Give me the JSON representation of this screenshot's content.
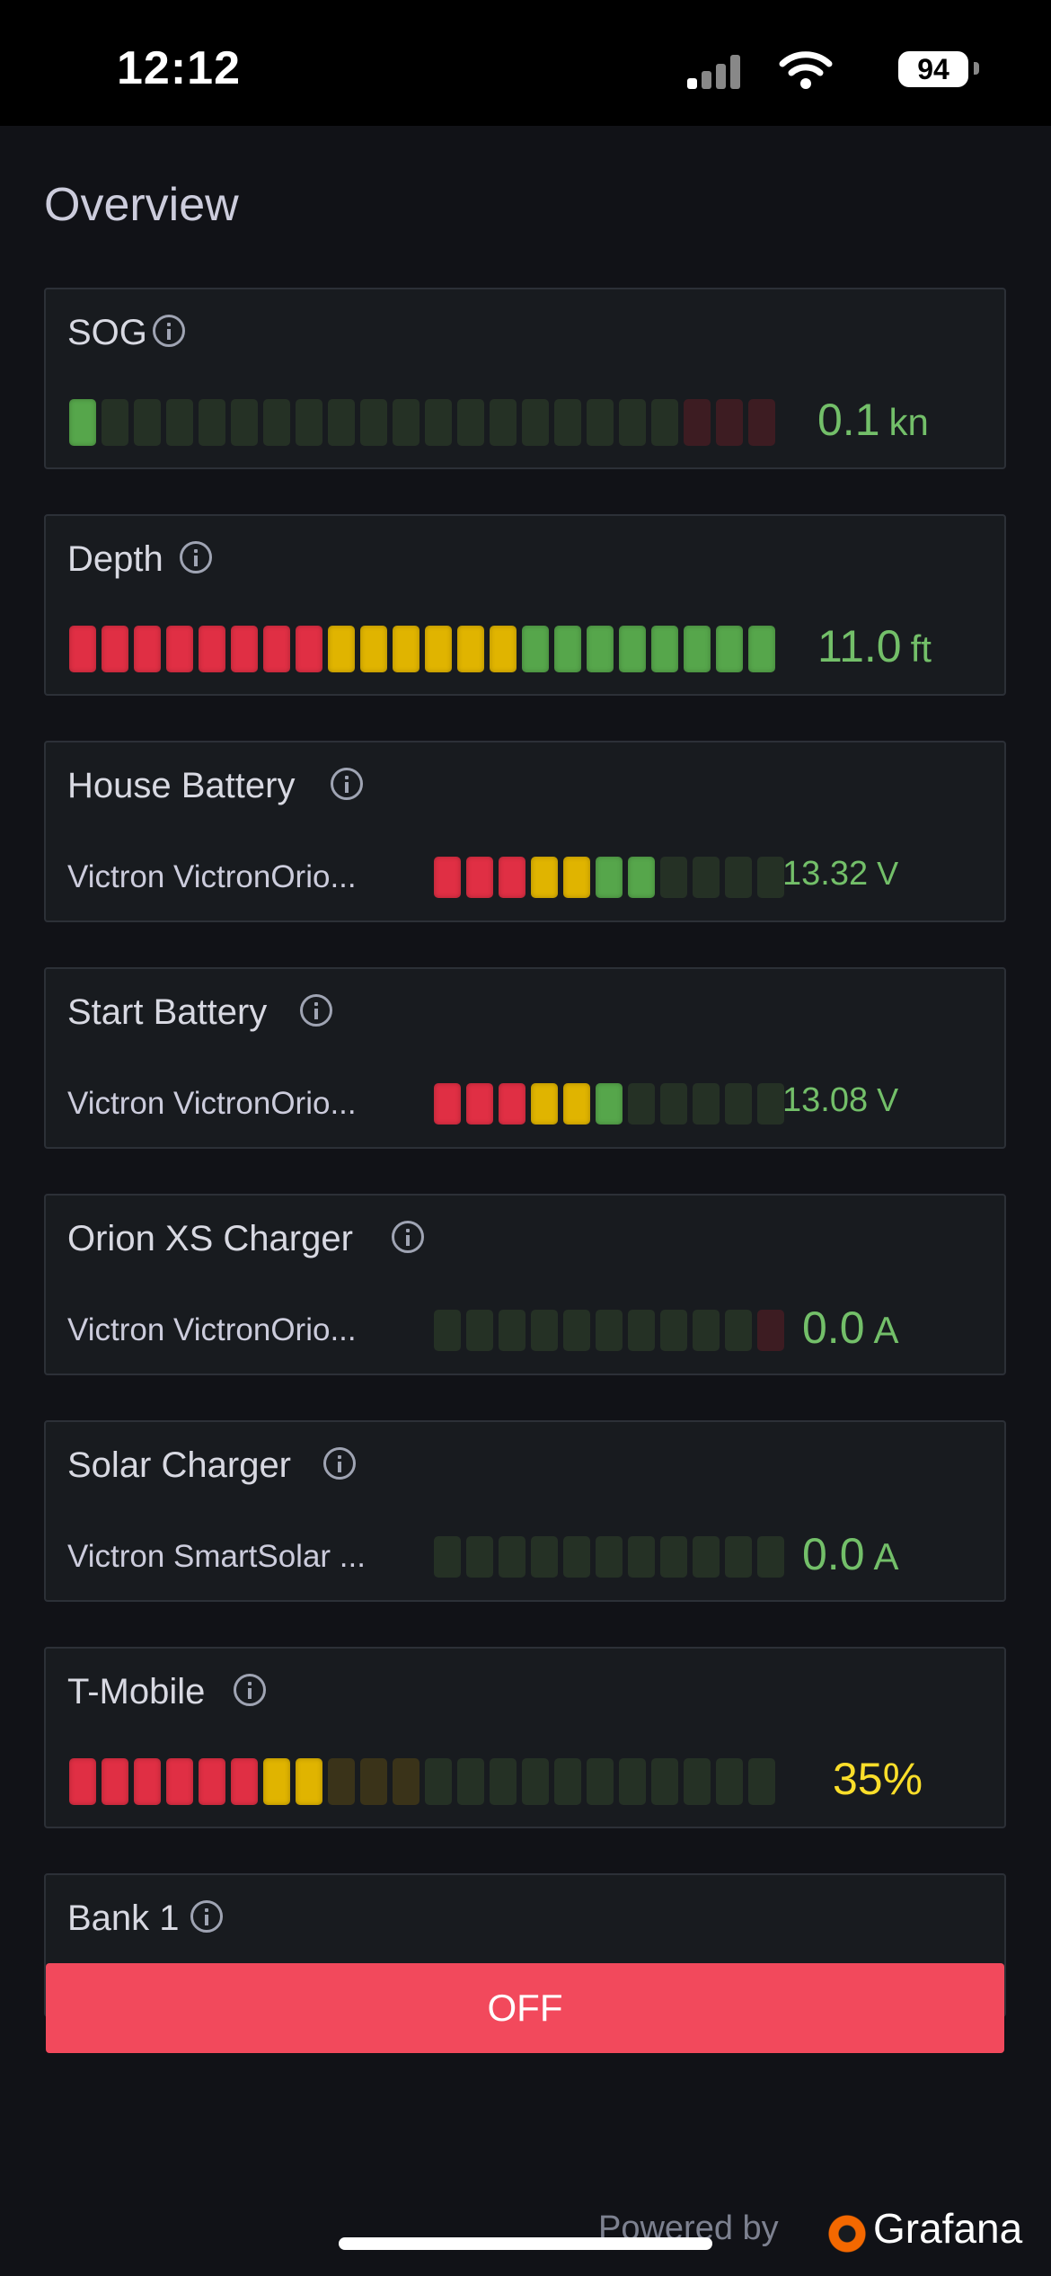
{
  "status_bar": {
    "time": "12:12",
    "battery": "94",
    "signal_icon": "cellular-signal-icon",
    "wifi_icon": "wifi-icon"
  },
  "page": {
    "title": "Overview"
  },
  "colors": {
    "red": "#e02f44",
    "yellow": "#e0b400",
    "green": "#56a64b",
    "dim_green": "#253125",
    "dim_red": "#3d1c22",
    "dim_yellow": "#3a3319",
    "value_green": "#73bf69",
    "value_yellow": "#fade2a"
  },
  "panels": [
    {
      "title": "SOG",
      "value": "0.1",
      "unit": "kn",
      "value_color": "value_green",
      "segments": 22,
      "lit": 1,
      "thresholds": [
        "g",
        "g",
        "g",
        "g",
        "g",
        "g",
        "g",
        "g",
        "g",
        "g",
        "g",
        "g",
        "g",
        "g",
        "g",
        "g",
        "g",
        "g",
        "g",
        "r",
        "r",
        "r"
      ]
    },
    {
      "title": "Depth",
      "value": "11.0",
      "unit": "ft",
      "value_color": "value_green",
      "segments": 22,
      "lit": 22,
      "thresholds": [
        "r",
        "r",
        "r",
        "r",
        "r",
        "r",
        "r",
        "r",
        "y",
        "y",
        "y",
        "y",
        "y",
        "y",
        "g",
        "g",
        "g",
        "g",
        "g",
        "g",
        "g",
        "g"
      ]
    },
    {
      "title": "House Battery",
      "device": "Victron VictronOrio...",
      "value": "13.32",
      "unit": "V",
      "value_color": "value_green",
      "segments": 11,
      "lit": 7,
      "thresholds": [
        "r",
        "r",
        "r",
        "y",
        "y",
        "g",
        "g",
        "g",
        "g",
        "g",
        "g"
      ]
    },
    {
      "title": "Start Battery",
      "device": "Victron VictronOrio...",
      "value": "13.08",
      "unit": "V",
      "value_color": "value_green",
      "segments": 11,
      "lit": 6,
      "thresholds": [
        "r",
        "r",
        "r",
        "y",
        "y",
        "g",
        "g",
        "g",
        "g",
        "g",
        "g"
      ]
    },
    {
      "title": "Orion XS Charger",
      "device": "Victron VictronOrio...",
      "value": "0.0",
      "unit": "A",
      "value_color": "value_green",
      "segments": 11,
      "lit": 0,
      "thresholds": [
        "g",
        "g",
        "g",
        "g",
        "g",
        "g",
        "g",
        "g",
        "g",
        "g",
        "r"
      ]
    },
    {
      "title": "Solar Charger",
      "device": "Victron SmartSolar ...",
      "value": "0.0",
      "unit": "A",
      "value_color": "value_green",
      "segments": 11,
      "lit": 0,
      "thresholds": [
        "g",
        "g",
        "g",
        "g",
        "g",
        "g",
        "g",
        "g",
        "g",
        "g",
        "g"
      ]
    },
    {
      "title": "T-Mobile",
      "value": "35%",
      "unit": "",
      "value_color": "value_yellow",
      "segments": 22,
      "lit": 8,
      "thresholds": [
        "r",
        "r",
        "r",
        "r",
        "r",
        "r",
        "y",
        "y",
        "y",
        "y",
        "y",
        "g",
        "g",
        "g",
        "g",
        "g",
        "g",
        "g",
        "g",
        "g",
        "g",
        "g"
      ]
    },
    {
      "title": "Bank 1"
    }
  ],
  "switch": {
    "label": "OFF"
  },
  "footer": {
    "powered_by": "Powered by",
    "brand": "Grafana"
  }
}
